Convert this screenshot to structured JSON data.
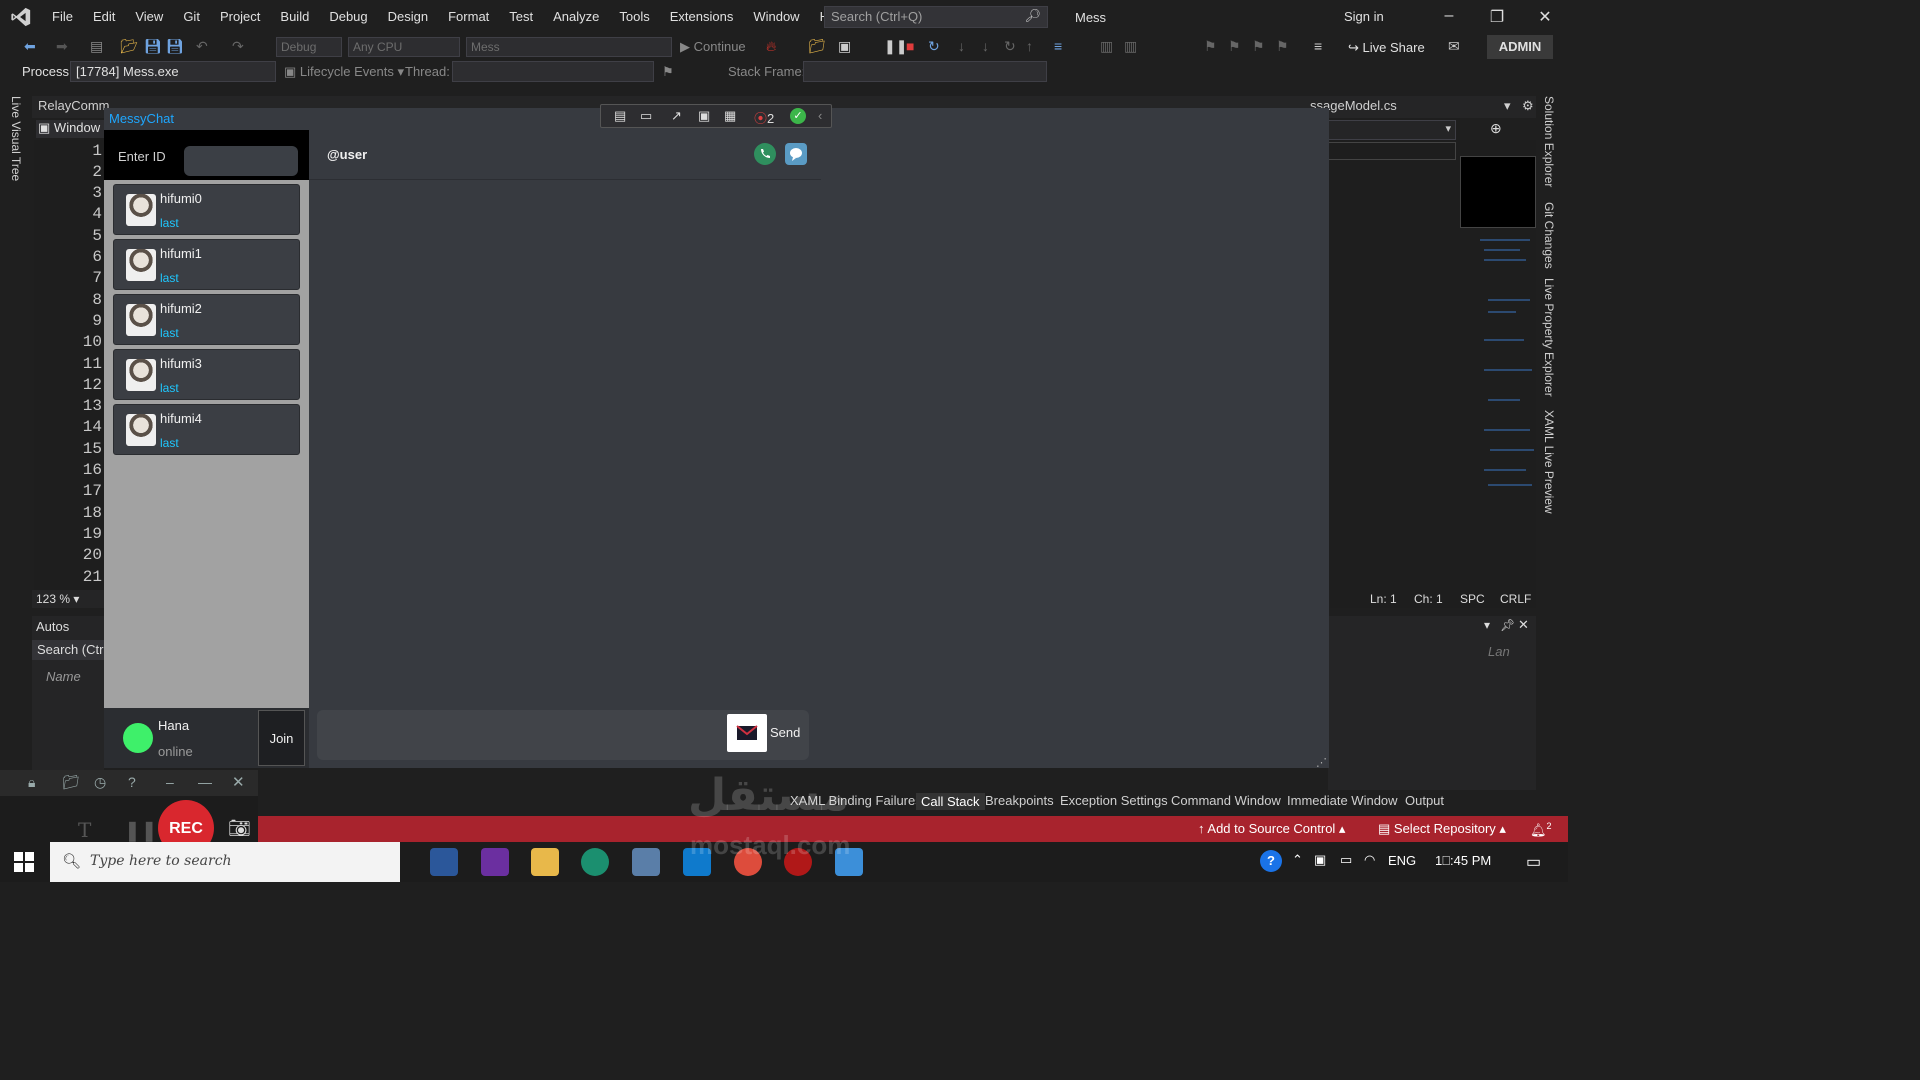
{
  "vs": {
    "menu": [
      "File",
      "Edit",
      "View",
      "Git",
      "Project",
      "Build",
      "Debug",
      "Design",
      "Format",
      "Test",
      "Analyze",
      "Tools",
      "Extensions",
      "Window",
      "Help"
    ],
    "search_placeholder": "Search (Ctrl+Q)",
    "solution_name": "Mess",
    "sign_in": "Sign in",
    "admin_badge": "ADMIN",
    "toolbar": {
      "config": "Debug",
      "platform": "Any CPU",
      "startup": "Mess",
      "continue": "Continue",
      "live_share": "Live Share"
    },
    "process_bar": {
      "process_label": "Process:",
      "process_value": "[17784] Mess.exe",
      "lifecycle": "Lifecycle Events",
      "thread_label": "Thread:",
      "stack_frame_label": "Stack Frame:"
    },
    "left_strip": "Live Visual Tree",
    "right_strip": [
      "Solution Explorer",
      "Git Changes",
      "Live Property Explorer",
      "XAML Live Preview"
    ],
    "doc_tabs": [
      "RelayComm",
      "ssageModel.cs"
    ],
    "window_label": "Window",
    "line_numbers": [
      "1",
      "2",
      "3",
      "4",
      "5",
      "6",
      "7",
      "8",
      "9",
      "10",
      "11",
      "12",
      "13",
      "14",
      "15",
      "16",
      "17",
      "18",
      "19",
      "20",
      "21"
    ],
    "zoom": "123 %",
    "editor_status": {
      "ln": "Ln: 1",
      "ch": "Ch: 1",
      "spc": "SPC",
      "crlf": "CRLF"
    },
    "autos": {
      "title": "Autos",
      "search": "Search (Ctrl+",
      "name_col": "Name"
    },
    "bottom_pane_right_hint": "Lan",
    "bottom_tabs": [
      "XAML Binding Failures",
      "Call Stack",
      "Breakpoints",
      "Exception Settings",
      "Command Window",
      "Immediate Window",
      "Output"
    ],
    "status": {
      "source_control": "Add to Source Control",
      "repo": "Select Repository",
      "notifications": "2"
    },
    "colors": {
      "status_bar": "#a8232d",
      "accent": "#1ea7ff",
      "online": "#3ef06a"
    }
  },
  "recorder": {
    "rec_label": "REC"
  },
  "taskbar": {
    "search_placeholder": "Type here to search",
    "language": "ENG",
    "time": "1⎕:45 PM"
  },
  "app": {
    "title": "MessyChat",
    "debug_badge_count": "2",
    "id_label": "Enter ID",
    "id_value": "",
    "chat_with": "@user",
    "contacts": [
      {
        "name": "hifumi0",
        "last": "last"
      },
      {
        "name": "hifumi1",
        "last": "last"
      },
      {
        "name": "hifumi2",
        "last": "last"
      },
      {
        "name": "hifumi3",
        "last": "last"
      },
      {
        "name": "hifumi4",
        "last": "last"
      }
    ],
    "current_user": {
      "name": "Hana",
      "status": "online"
    },
    "join_label": "Join",
    "send_label": "Send",
    "message_value": ""
  },
  "watermark": {
    "arabic": "مستقل",
    "latin": "mostaql.com"
  }
}
